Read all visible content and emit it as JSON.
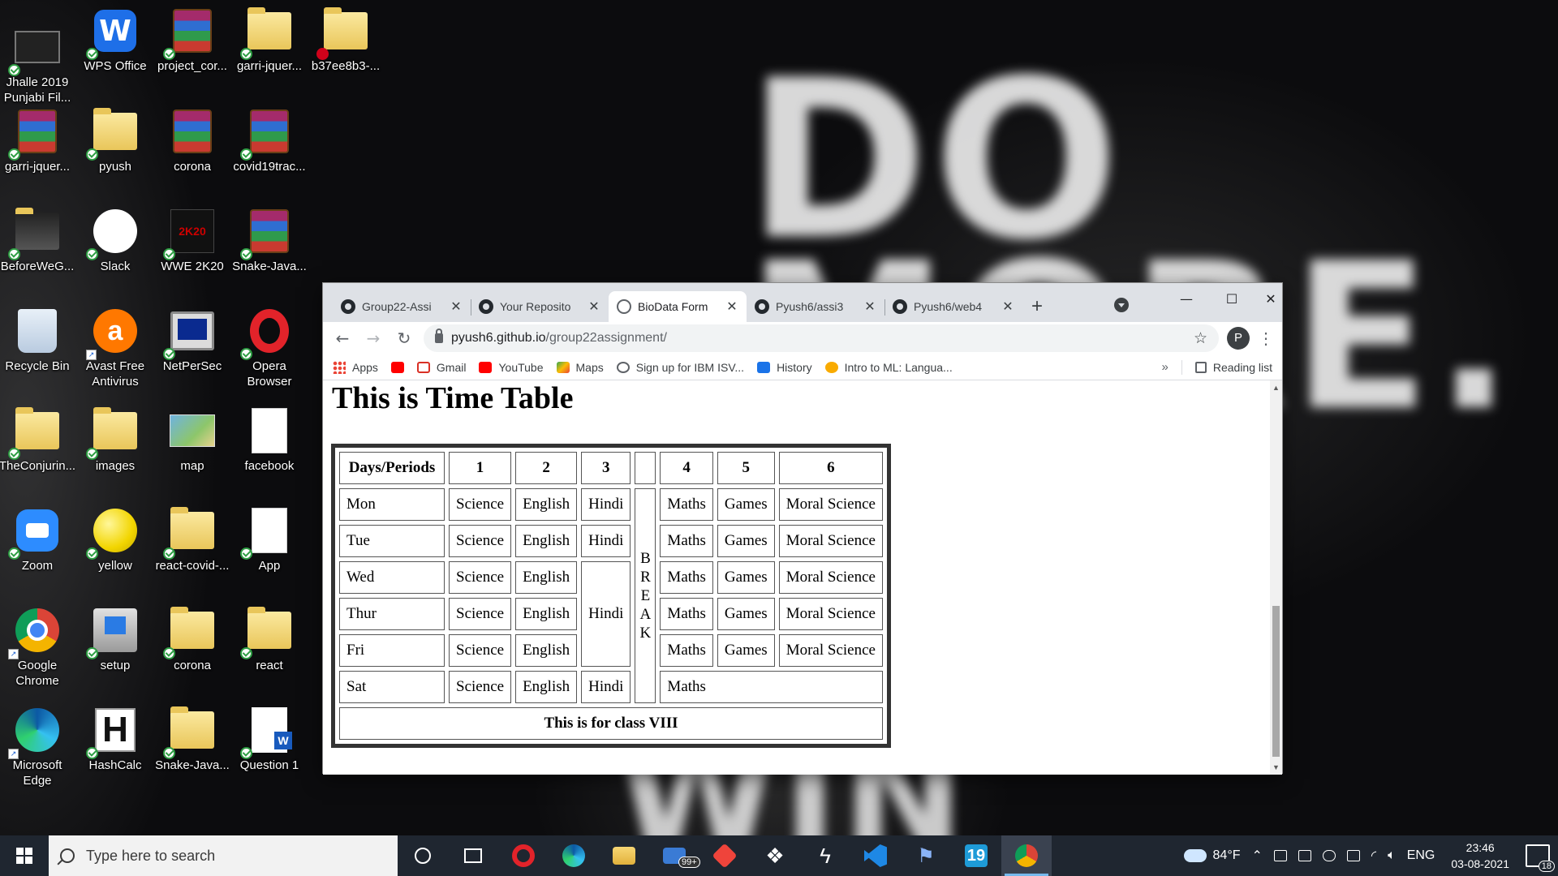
{
  "desktop": {
    "icons": [
      {
        "label": "Jhalle 2019 Punjabi Fil...",
        "icon": "video-file-icon"
      },
      {
        "label": "WPS Office",
        "icon": "wps-office-icon"
      },
      {
        "label": "project_cor...",
        "icon": "winrar-archive-icon"
      },
      {
        "label": "garri-jquer...",
        "icon": "opera-folder-icon"
      },
      {
        "label": "b37ee8b3-...",
        "icon": "folder-icon"
      },
      {
        "label": "garri-jquer...",
        "icon": "winrar-archive-icon"
      },
      {
        "label": "pyush",
        "icon": "folder-icon"
      },
      {
        "label": "corona",
        "icon": "winrar-archive-icon"
      },
      {
        "label": "covid19trac...",
        "icon": "winrar-archive-icon"
      },
      {
        "label": "BeforeWeG...",
        "icon": "folder-icon"
      },
      {
        "label": "Slack",
        "icon": "slack-icon"
      },
      {
        "label": "WWE 2K20",
        "icon": "game-icon"
      },
      {
        "label": "Snake-Java...",
        "icon": "winrar-archive-icon"
      },
      {
        "label": "Recycle Bin",
        "icon": "recycle-bin-icon"
      },
      {
        "label": "Avast Free Antivirus",
        "icon": "avast-icon"
      },
      {
        "label": "NetPerSec",
        "icon": "netpersec-icon"
      },
      {
        "label": "Opera Browser",
        "icon": "opera-icon"
      },
      {
        "label": "TheConjurin...",
        "icon": "opera-folder-icon"
      },
      {
        "label": "images",
        "icon": "folder-icon"
      },
      {
        "label": "map",
        "icon": "map-image-icon"
      },
      {
        "label": "facebook",
        "icon": "blank-file-icon"
      },
      {
        "label": "Zoom",
        "icon": "zoom-icon"
      },
      {
        "label": "yellow",
        "icon": "yellow-ball-icon"
      },
      {
        "label": "react-covid-...",
        "icon": "folder-icon"
      },
      {
        "label": "App",
        "icon": "document-icon"
      },
      {
        "label": "Google Chrome",
        "icon": "chrome-icon"
      },
      {
        "label": "setup",
        "icon": "setup-icon"
      },
      {
        "label": "corona",
        "icon": "opera-folder-icon"
      },
      {
        "label": "react",
        "icon": "opera-folder-icon"
      },
      {
        "label": "Microsoft Edge",
        "icon": "edge-icon"
      },
      {
        "label": "HashCalc",
        "icon": "hashcalc-icon"
      },
      {
        "label": "Snake-Java...",
        "icon": "folder-icon"
      },
      {
        "label": "Question 1",
        "icon": "word-document-icon"
      }
    ]
  },
  "browser": {
    "tabs": [
      {
        "title": "Group22-Assi",
        "icon": "github-icon",
        "active": false
      },
      {
        "title": "Your Reposito",
        "icon": "github-icon",
        "active": false
      },
      {
        "title": "BioData Form",
        "icon": "globe-icon",
        "active": true
      },
      {
        "title": "Pyush6/assi3",
        "icon": "github-icon",
        "active": false
      },
      {
        "title": "Pyush6/web4",
        "icon": "github-icon",
        "active": false
      }
    ],
    "close_glyph": "✕",
    "new_tab_glyph": "+",
    "window_controls": {
      "minimize": "—",
      "maximize": "☐",
      "close": "✕"
    },
    "nav": {
      "back": "←",
      "forward": "→",
      "reload": "↻"
    },
    "address": {
      "host": "pyush6.github.io",
      "path": "/group22assignment/"
    },
    "profile_initial": "P",
    "bookmarks": [
      {
        "label": "Apps",
        "color": "#ea4335"
      },
      {
        "label": "",
        "color": "#ff0000"
      },
      {
        "label": "Gmail",
        "color": "#d93025"
      },
      {
        "label": "YouTube",
        "color": "#ff0000"
      },
      {
        "label": "Maps",
        "color": "#34a853"
      },
      {
        "label": "Sign up for IBM ISV...",
        "color": "#5f6368"
      },
      {
        "label": "History",
        "color": "#1a73e8"
      },
      {
        "label": "Intro to ML: Langua...",
        "color": "#f9ab00"
      }
    ],
    "bookmarks_overflow": "»",
    "reading_list": "Reading list"
  },
  "page": {
    "heading": "This is Time Table",
    "table": {
      "headers": [
        "Days/Periods",
        "1",
        "2",
        "3",
        "",
        "4",
        "5",
        "6"
      ],
      "break_letters": "B R E A K",
      "rows": [
        {
          "day": "Mon",
          "p1": "Science",
          "p2": "English",
          "p3": "Hindi",
          "p4": "Maths",
          "p5": "Games",
          "p6": "Moral Science"
        },
        {
          "day": "Tue",
          "p1": "Science",
          "p2": "English",
          "p3": "Hindi",
          "p4": "Maths",
          "p5": "Games",
          "p6": "Moral Science"
        },
        {
          "day": "Wed",
          "p1": "Science",
          "p2": "English",
          "p3": "Hindi",
          "p4": "Maths",
          "p5": "Games",
          "p6": "Moral Science"
        },
        {
          "day": "Thur",
          "p1": "Science",
          "p2": "English",
          "p4": "Maths",
          "p5": "Games",
          "p6": "Moral Science"
        },
        {
          "day": "Fri",
          "p1": "Science",
          "p2": "English",
          "p4": "Maths",
          "p5": "Games",
          "p6": "Moral Science"
        },
        {
          "day": "Sat",
          "p1": "Science",
          "p2": "English",
          "p3": "Hindi",
          "p4": "Maths"
        }
      ],
      "footer": "This is for class VIII"
    }
  },
  "taskbar": {
    "search_placeholder": "Type here to search",
    "mail_badge": "99+",
    "temperature": "84°F",
    "language": "ENG",
    "time": "23:46",
    "date": "03-08-2021",
    "notification_count": "18"
  },
  "wallpaper": {
    "words": [
      "DO",
      "MORE.",
      "WIN"
    ]
  }
}
